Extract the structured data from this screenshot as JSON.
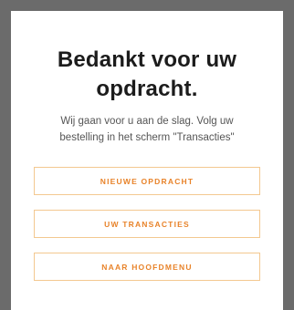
{
  "confirmation": {
    "title_line1": "Bedankt voor uw",
    "title_line2": "opdracht.",
    "message_line1": "Wij gaan voor u aan de slag. Volg uw",
    "message_line2": "bestelling in het scherm \"Transacties\""
  },
  "actions": {
    "new_order_label": "NIEUWE OPDRACHT",
    "transactions_label": "UW TRANSACTIES",
    "main_menu_label": "NAAR HOOFDMENU"
  },
  "colors": {
    "accent": "#e8832a",
    "button_border": "#f3c890",
    "title_text": "#1c1c1c",
    "body_text": "#555555",
    "backdrop": "#6b6b6b"
  }
}
